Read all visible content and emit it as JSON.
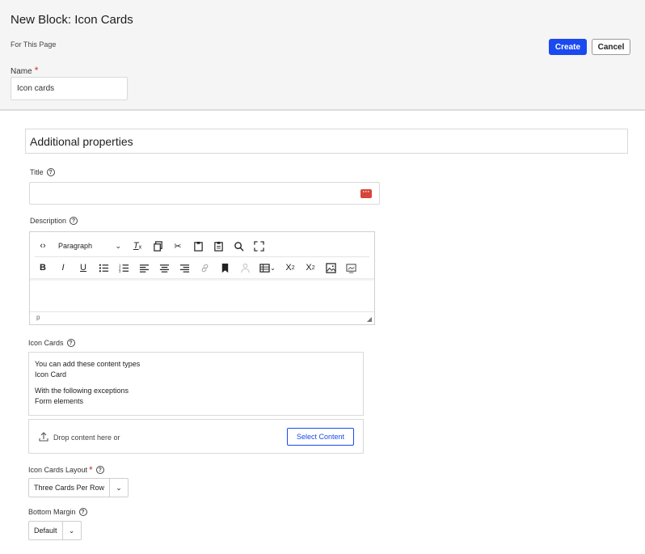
{
  "header": {
    "title": "New Block: Icon Cards",
    "subtitle": "For This Page",
    "create_label": "Create",
    "cancel_label": "Cancel",
    "name_label": "Name",
    "required_mark": "*",
    "name_value": "Icon cards"
  },
  "section": {
    "title": "Additional properties"
  },
  "title_field": {
    "label": "Title",
    "value": ""
  },
  "description": {
    "label": "Description",
    "format_select": "Paragraph",
    "status_path": "p"
  },
  "icon_cards": {
    "label": "Icon Cards",
    "allowed_heading": "You can add these content types",
    "allowed_types": [
      "Icon Card"
    ],
    "exceptions_heading": "With the following exceptions",
    "exceptions": [
      "Form elements"
    ],
    "drop_text": "Drop content here or",
    "select_content_label": "Select Content"
  },
  "layout": {
    "label": "Icon Cards Layout",
    "required_mark": "*",
    "value": "Three Cards Per Row"
  },
  "bottom_margin": {
    "label": "Bottom Margin",
    "value": "Default"
  },
  "help_glyph": "?",
  "colors": {
    "primary": "#1a49f0",
    "required": "#d32f2f",
    "header_bg": "#f5f5f5"
  }
}
